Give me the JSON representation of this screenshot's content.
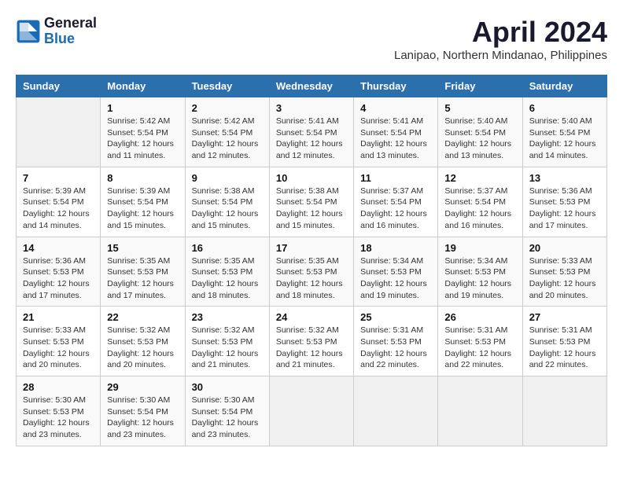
{
  "header": {
    "logo_line1": "General",
    "logo_line2": "Blue",
    "month_title": "April 2024",
    "location": "Lanipao, Northern Mindanao, Philippines"
  },
  "weekdays": [
    "Sunday",
    "Monday",
    "Tuesday",
    "Wednesday",
    "Thursday",
    "Friday",
    "Saturday"
  ],
  "weeks": [
    [
      {
        "day": "",
        "info": ""
      },
      {
        "day": "1",
        "info": "Sunrise: 5:42 AM\nSunset: 5:54 PM\nDaylight: 12 hours\nand 11 minutes."
      },
      {
        "day": "2",
        "info": "Sunrise: 5:42 AM\nSunset: 5:54 PM\nDaylight: 12 hours\nand 12 minutes."
      },
      {
        "day": "3",
        "info": "Sunrise: 5:41 AM\nSunset: 5:54 PM\nDaylight: 12 hours\nand 12 minutes."
      },
      {
        "day": "4",
        "info": "Sunrise: 5:41 AM\nSunset: 5:54 PM\nDaylight: 12 hours\nand 13 minutes."
      },
      {
        "day": "5",
        "info": "Sunrise: 5:40 AM\nSunset: 5:54 PM\nDaylight: 12 hours\nand 13 minutes."
      },
      {
        "day": "6",
        "info": "Sunrise: 5:40 AM\nSunset: 5:54 PM\nDaylight: 12 hours\nand 14 minutes."
      }
    ],
    [
      {
        "day": "7",
        "info": "Sunrise: 5:39 AM\nSunset: 5:54 PM\nDaylight: 12 hours\nand 14 minutes."
      },
      {
        "day": "8",
        "info": "Sunrise: 5:39 AM\nSunset: 5:54 PM\nDaylight: 12 hours\nand 15 minutes."
      },
      {
        "day": "9",
        "info": "Sunrise: 5:38 AM\nSunset: 5:54 PM\nDaylight: 12 hours\nand 15 minutes."
      },
      {
        "day": "10",
        "info": "Sunrise: 5:38 AM\nSunset: 5:54 PM\nDaylight: 12 hours\nand 15 minutes."
      },
      {
        "day": "11",
        "info": "Sunrise: 5:37 AM\nSunset: 5:54 PM\nDaylight: 12 hours\nand 16 minutes."
      },
      {
        "day": "12",
        "info": "Sunrise: 5:37 AM\nSunset: 5:54 PM\nDaylight: 12 hours\nand 16 minutes."
      },
      {
        "day": "13",
        "info": "Sunrise: 5:36 AM\nSunset: 5:53 PM\nDaylight: 12 hours\nand 17 minutes."
      }
    ],
    [
      {
        "day": "14",
        "info": "Sunrise: 5:36 AM\nSunset: 5:53 PM\nDaylight: 12 hours\nand 17 minutes."
      },
      {
        "day": "15",
        "info": "Sunrise: 5:35 AM\nSunset: 5:53 PM\nDaylight: 12 hours\nand 17 minutes."
      },
      {
        "day": "16",
        "info": "Sunrise: 5:35 AM\nSunset: 5:53 PM\nDaylight: 12 hours\nand 18 minutes."
      },
      {
        "day": "17",
        "info": "Sunrise: 5:35 AM\nSunset: 5:53 PM\nDaylight: 12 hours\nand 18 minutes."
      },
      {
        "day": "18",
        "info": "Sunrise: 5:34 AM\nSunset: 5:53 PM\nDaylight: 12 hours\nand 19 minutes."
      },
      {
        "day": "19",
        "info": "Sunrise: 5:34 AM\nSunset: 5:53 PM\nDaylight: 12 hours\nand 19 minutes."
      },
      {
        "day": "20",
        "info": "Sunrise: 5:33 AM\nSunset: 5:53 PM\nDaylight: 12 hours\nand 20 minutes."
      }
    ],
    [
      {
        "day": "21",
        "info": "Sunrise: 5:33 AM\nSunset: 5:53 PM\nDaylight: 12 hours\nand 20 minutes."
      },
      {
        "day": "22",
        "info": "Sunrise: 5:32 AM\nSunset: 5:53 PM\nDaylight: 12 hours\nand 20 minutes."
      },
      {
        "day": "23",
        "info": "Sunrise: 5:32 AM\nSunset: 5:53 PM\nDaylight: 12 hours\nand 21 minutes."
      },
      {
        "day": "24",
        "info": "Sunrise: 5:32 AM\nSunset: 5:53 PM\nDaylight: 12 hours\nand 21 minutes."
      },
      {
        "day": "25",
        "info": "Sunrise: 5:31 AM\nSunset: 5:53 PM\nDaylight: 12 hours\nand 22 minutes."
      },
      {
        "day": "26",
        "info": "Sunrise: 5:31 AM\nSunset: 5:53 PM\nDaylight: 12 hours\nand 22 minutes."
      },
      {
        "day": "27",
        "info": "Sunrise: 5:31 AM\nSunset: 5:53 PM\nDaylight: 12 hours\nand 22 minutes."
      }
    ],
    [
      {
        "day": "28",
        "info": "Sunrise: 5:30 AM\nSunset: 5:53 PM\nDaylight: 12 hours\nand 23 minutes."
      },
      {
        "day": "29",
        "info": "Sunrise: 5:30 AM\nSunset: 5:54 PM\nDaylight: 12 hours\nand 23 minutes."
      },
      {
        "day": "30",
        "info": "Sunrise: 5:30 AM\nSunset: 5:54 PM\nDaylight: 12 hours\nand 23 minutes."
      },
      {
        "day": "",
        "info": ""
      },
      {
        "day": "",
        "info": ""
      },
      {
        "day": "",
        "info": ""
      },
      {
        "day": "",
        "info": ""
      }
    ]
  ]
}
